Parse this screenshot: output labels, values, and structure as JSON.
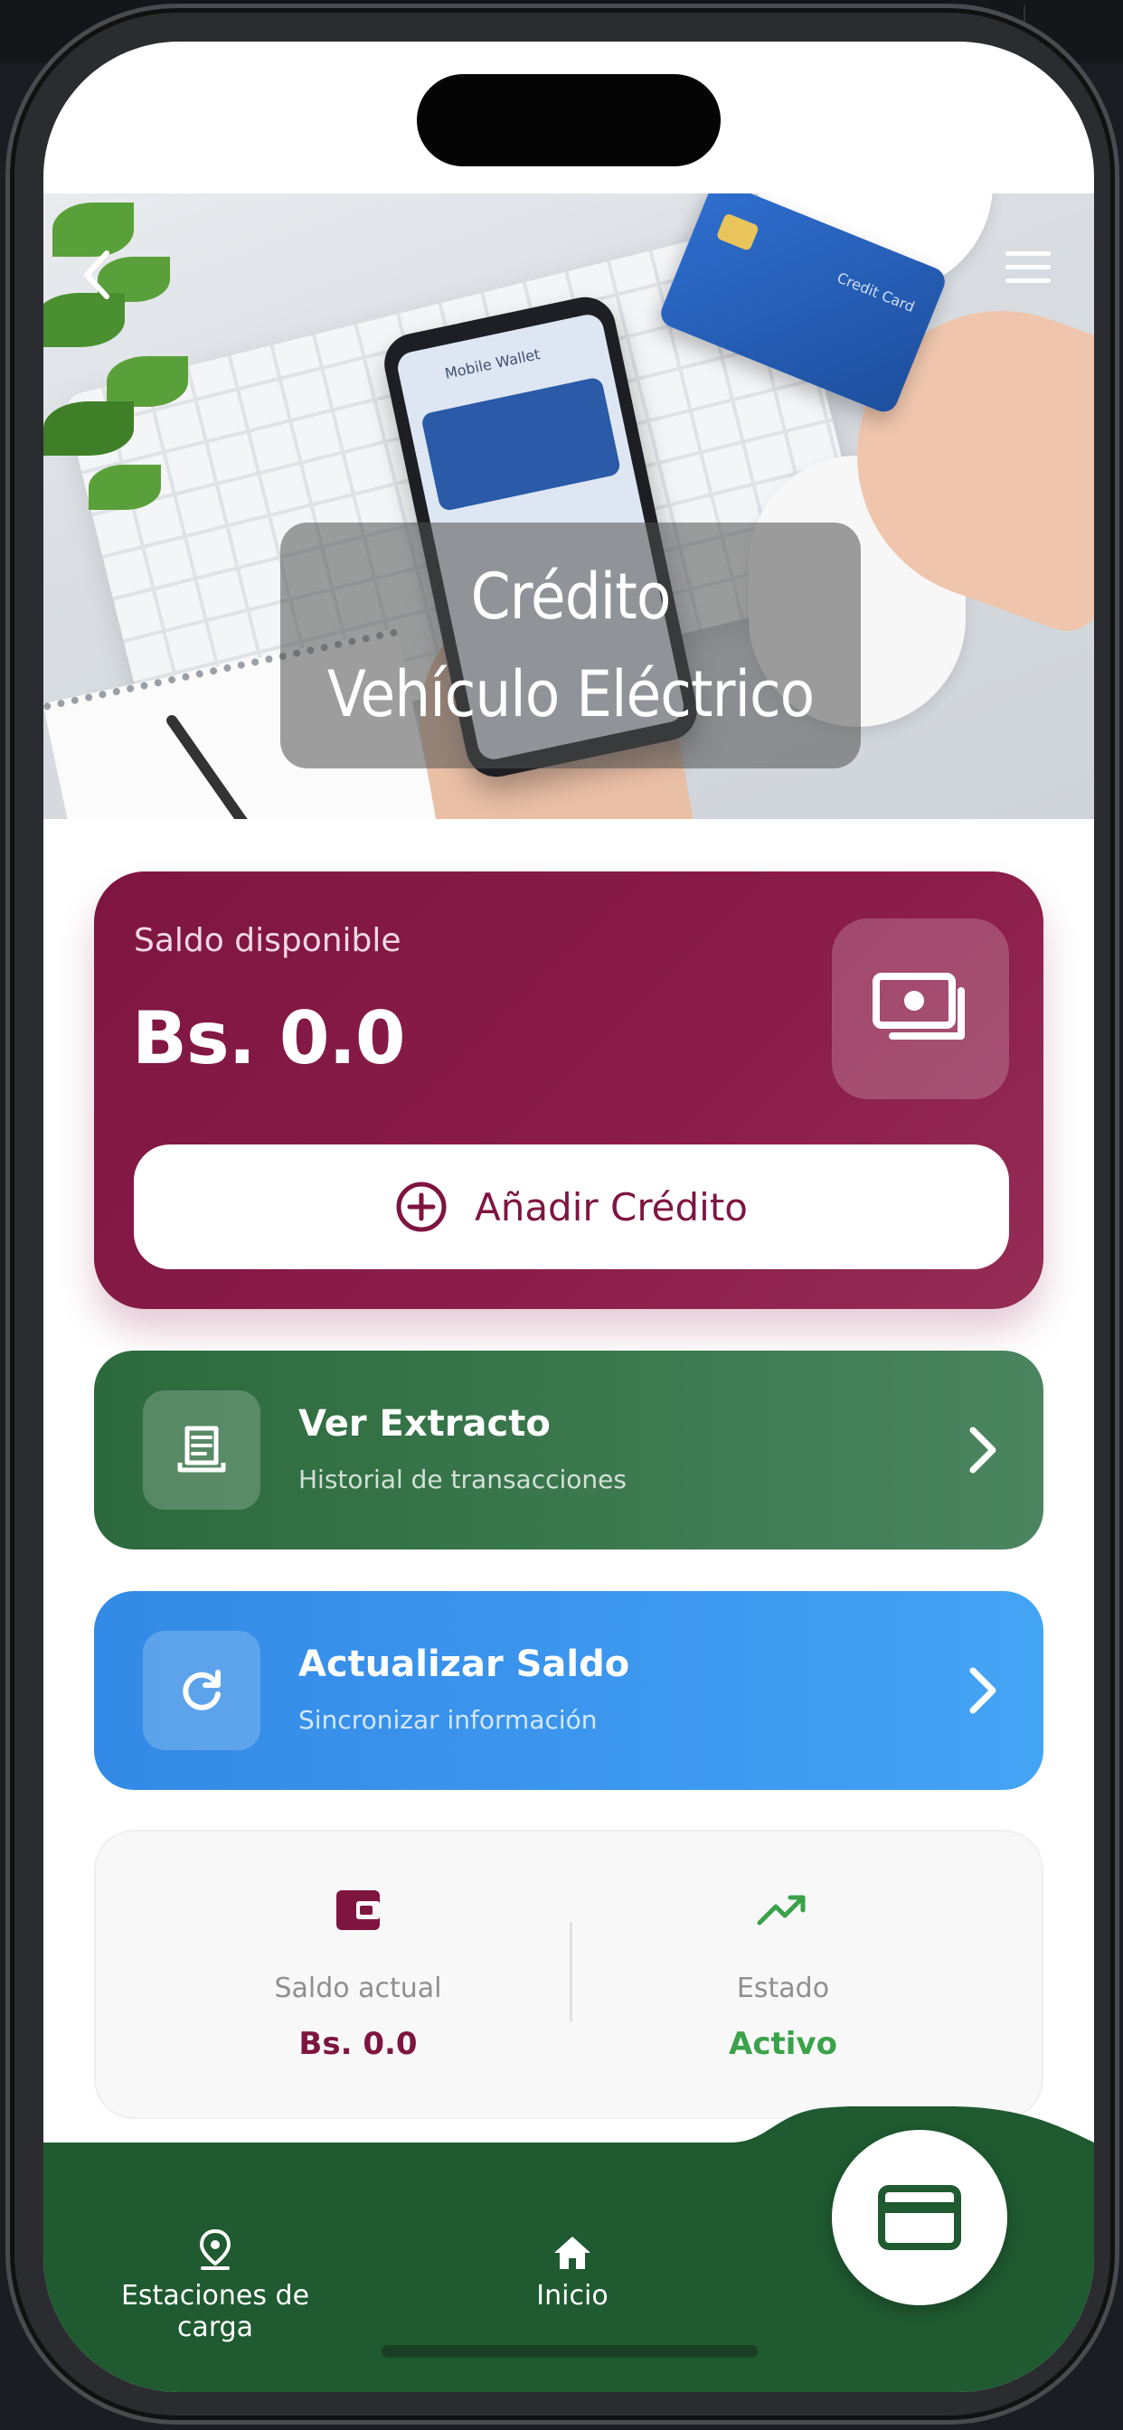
{
  "hero": {
    "title_line1": "Crédito",
    "title_line2": "Vehículo Eléctrico",
    "back_icon": "chevron-left-icon",
    "menu_icon": "hamburger-menu-icon",
    "photo_phone_text": "Mobile Wallet",
    "photo_card_text": "Credit Card"
  },
  "balance_card": {
    "label": "Saldo disponible",
    "amount": "Bs. 0.0",
    "icon": "money-stack-icon",
    "add_button_label": "Añadir Crédito",
    "add_button_icon": "plus-circle-icon",
    "background_color": "#7e1541"
  },
  "actions": [
    {
      "title": "Ver Extracto",
      "subtitle": "Historial de transacciones",
      "icon": "receipt-icon",
      "color": "#2c6a3d"
    },
    {
      "title": "Actualizar Saldo",
      "subtitle": "Sincronizar información",
      "icon": "refresh-icon",
      "color": "#338ae6"
    }
  ],
  "summary": {
    "left": {
      "caption": "Saldo actual",
      "value": "Bs. 0.0",
      "icon": "wallet-icon"
    },
    "right": {
      "caption": "Estado",
      "value": "Activo",
      "icon": "trending-up-icon"
    }
  },
  "bottom_nav": {
    "items": [
      {
        "label": "Estaciones de carga",
        "icon": "location-pin-icon"
      },
      {
        "label": "Inicio",
        "icon": "home-icon"
      }
    ],
    "fab_icon": "credit-card-icon",
    "background_color": "#1f5a30"
  }
}
